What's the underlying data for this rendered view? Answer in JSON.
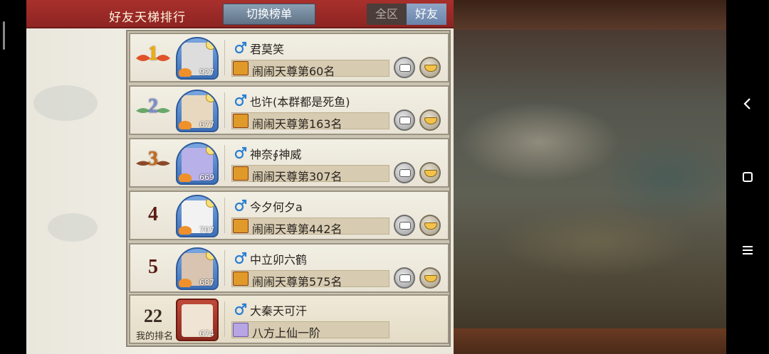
{
  "header": {
    "title": "好友天梯排行",
    "switch_label": "切换榜单",
    "segments": {
      "all": "全区",
      "friends": "好友"
    }
  },
  "entries": [
    {
      "rank": "1",
      "rank_style": "gold",
      "name": "君莫笑",
      "power": "927",
      "title": "闹闹天尊第60名",
      "title_icon": "ladder-badge-icon"
    },
    {
      "rank": "2",
      "rank_style": "silver",
      "name": "也许(本群都是死鱼)",
      "power": "677",
      "title": "闹闹天尊第163名",
      "title_icon": "ladder-badge-icon"
    },
    {
      "rank": "3",
      "rank_style": "bronze",
      "name": "神奈∮神威",
      "power": "669",
      "title": "闹闹天尊第307名",
      "title_icon": "ladder-badge-icon"
    },
    {
      "rank": "4",
      "rank_style": "plain",
      "name": "今夕何夕a",
      "power": "707",
      "title": "闹闹天尊第442名",
      "title_icon": "ladder-badge-icon"
    },
    {
      "rank": "5",
      "rank_style": "plain",
      "name": "中立卯六鹤",
      "power": "687",
      "title": "闹闹天尊第575名",
      "title_icon": "ladder-badge-icon"
    }
  ],
  "my_rank": {
    "rank": "22",
    "label": "我的排名",
    "name": "大秦天可汗",
    "power": "674",
    "title": "八方上仙一阶",
    "title_icon": "immortal-badge-icon"
  },
  "icons": {
    "gender": "male-icon",
    "chat": "chat-icon",
    "gift": "bowl-gift-icon",
    "nav_back": "back-icon",
    "nav_home": "home-icon",
    "nav_menu": "menu-icon"
  },
  "colors": {
    "header_red": "#a8302c",
    "segment_active": "#6a84aa",
    "male_blue": "#2a7fd4"
  }
}
